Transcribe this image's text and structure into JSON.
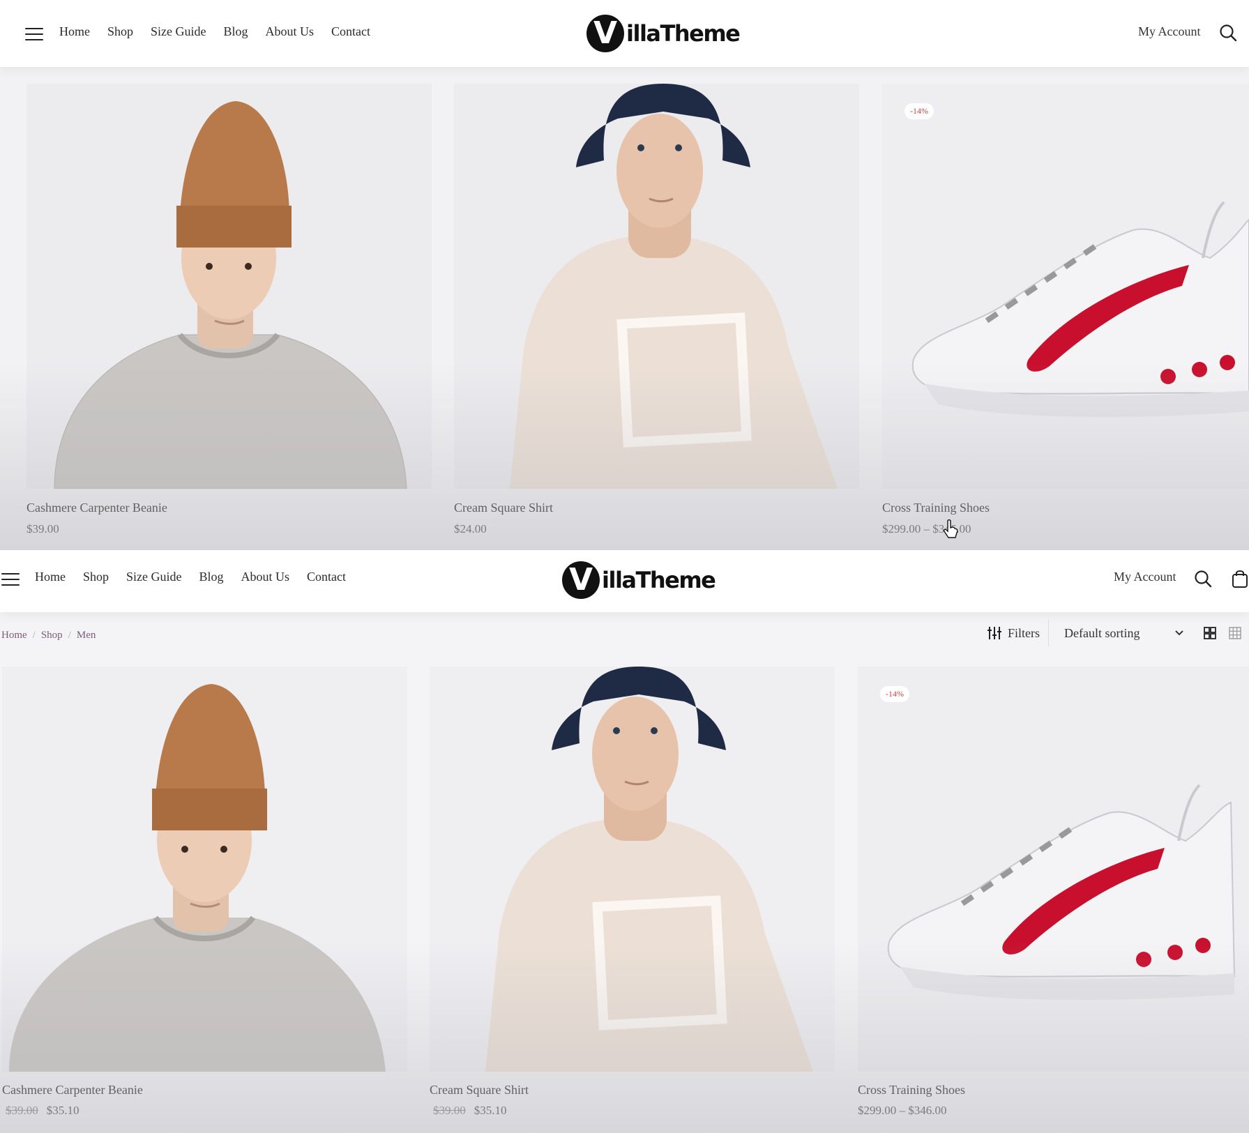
{
  "header": {
    "brand": "VillaTheme",
    "logo_letter": "V",
    "logo_text": "illaTheme",
    "nav": [
      "Home",
      "Shop",
      "Size Guide",
      "Blog",
      "About Us",
      "Contact"
    ],
    "account_label": "My Account"
  },
  "top_panel": {
    "products": [
      {
        "title": "Cashmere Carpenter Beanie",
        "price": "$39.00"
      },
      {
        "title": "Cream Square Shirt",
        "price": "$24.00"
      },
      {
        "title": "Cross Training Shoes",
        "price": "$299.00 – $346.00",
        "badge": "-14%"
      }
    ]
  },
  "bottom_panel": {
    "breadcrumb": [
      "Home",
      "Shop",
      "Men"
    ],
    "breadcrumb_sep": "/",
    "filters_label": "Filters",
    "sorting_value": "Default sorting",
    "products": [
      {
        "title": "Cashmere Carpenter Beanie",
        "old_price": "$39.00",
        "price": "$35.10"
      },
      {
        "title": "Cream Square Shirt",
        "old_price": "$39.00",
        "price": "$35.10"
      },
      {
        "title": "Cross Training Shoes",
        "price": "$299.00 – $346.00",
        "badge": "-14%"
      }
    ]
  },
  "colors": {
    "accent_badge": "#cc4444",
    "breadcrumb": "#7a5c7a",
    "shoe_swoosh": "#c8102e",
    "beanie": "#b87a4b"
  }
}
